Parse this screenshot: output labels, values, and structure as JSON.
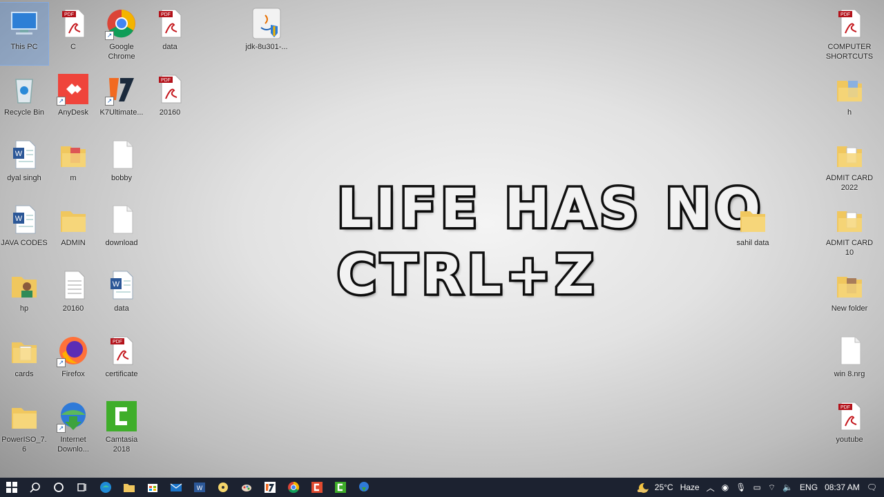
{
  "wallpaper": {
    "line1": "LIFE HAS NO",
    "line2": "CTRL+Z"
  },
  "desktop_icons": [
    {
      "label": "This PC",
      "icon": "computer-icon"
    },
    {
      "label": "C",
      "icon": "pdf-file-icon"
    },
    {
      "label": "Google Chrome",
      "icon": "chrome-icon"
    },
    {
      "label": "data",
      "icon": "pdf-file-icon"
    },
    {
      "label": "jdk-8u301-...",
      "icon": "java-installer-icon"
    },
    {
      "label": "COMPUTER SHORTCUTS",
      "icon": "pdf-file-icon"
    },
    {
      "label": "Recycle Bin",
      "icon": "recycle-bin-icon"
    },
    {
      "label": "AnyDesk",
      "icon": "anydesk-icon"
    },
    {
      "label": "K7Ultimate...",
      "icon": "k7-icon"
    },
    {
      "label": "20160",
      "icon": "pdf-file-icon"
    },
    {
      "label": "h",
      "icon": "folder-icon"
    },
    {
      "label": "dyal singh",
      "icon": "word-doc-icon"
    },
    {
      "label": "m",
      "icon": "folder-icon"
    },
    {
      "label": "bobby",
      "icon": "blank-file-icon"
    },
    {
      "label": "ADMIT CARD 2022",
      "icon": "folder-icon"
    },
    {
      "label": "JAVA CODES",
      "icon": "word-doc-icon"
    },
    {
      "label": "ADMIN",
      "icon": "folder-icon"
    },
    {
      "label": "download",
      "icon": "blank-file-icon"
    },
    {
      "label": "sahil data",
      "icon": "folder-icon"
    },
    {
      "label": "ADMIT CARD 10",
      "icon": "folder-icon"
    },
    {
      "label": "hp",
      "icon": "user-folder-icon"
    },
    {
      "label": "20160",
      "icon": "text-file-icon"
    },
    {
      "label": "data",
      "icon": "word-doc-icon"
    },
    {
      "label": "New folder",
      "icon": "folder-icon"
    },
    {
      "label": "cards",
      "icon": "folder-icon"
    },
    {
      "label": "Firefox",
      "icon": "firefox-icon"
    },
    {
      "label": "certificate",
      "icon": "pdf-file-icon"
    },
    {
      "label": "win 8.nrg",
      "icon": "blank-file-icon"
    },
    {
      "label": "PowerISO_7.6",
      "icon": "folder-icon"
    },
    {
      "label": "Internet Downlo...",
      "icon": "idm-icon"
    },
    {
      "label": "Camtasia 2018",
      "icon": "camtasia-icon"
    },
    {
      "label": "youtube",
      "icon": "pdf-file-icon"
    }
  ],
  "taskbar": {
    "pinned": [
      "start-icon",
      "search-icon",
      "cortana-icon",
      "task-view-icon",
      "edge-icon",
      "file-explorer-icon",
      "store-icon",
      "mail-icon",
      "word-icon",
      "media-player-icon",
      "paint-icon",
      "k7-icon",
      "chrome-icon",
      "camtasia-recorder-icon",
      "camtasia-icon",
      "idm-icon"
    ],
    "weather_temp": "25°C",
    "weather_text": "Haze",
    "language": "ENG",
    "time": "08:37 AM"
  }
}
